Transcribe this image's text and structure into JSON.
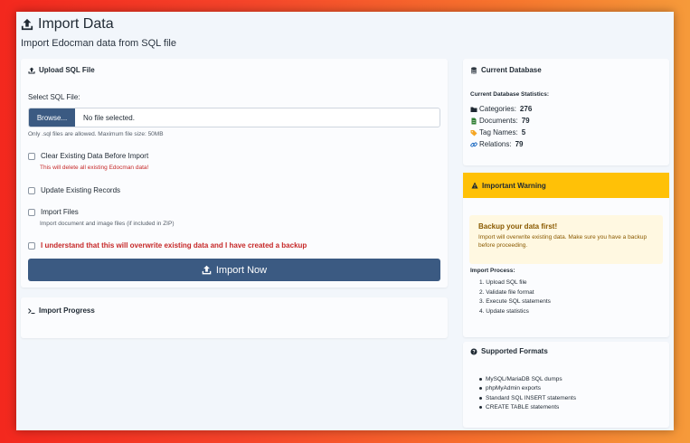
{
  "header": {
    "title": "Import Data",
    "subtitle": "Import Edocman data from SQL file"
  },
  "upload": {
    "card_title": "Upload SQL File",
    "file_label": "Select SQL File:",
    "browse_label": "Browse...",
    "file_value": "No file selected.",
    "hint": "Only .sql files are allowed. Maximum file size: 50MB",
    "options": {
      "clear": {
        "label": "Clear Existing Data Before Import",
        "sub": "This will delete all existing Edocman data!",
        "checked": false
      },
      "update": {
        "label": "Update Existing Records",
        "checked": false
      },
      "files": {
        "label": "Import Files",
        "sub": "Import document and image files (if included in ZIP)",
        "checked": false
      },
      "confirm": {
        "label": "I understand that this will overwrite existing data and I have created a backup",
        "checked": false
      }
    },
    "import_button": "Import Now"
  },
  "progress": {
    "card_title": "Import Progress"
  },
  "database": {
    "card_title": "Current Database",
    "stats_title": "Current Database Statistics:",
    "stats": [
      {
        "label": "Categories:",
        "value": "276",
        "icon": "folder-icon"
      },
      {
        "label": "Documents:",
        "value": "79",
        "icon": "document-icon"
      },
      {
        "label": "Tag Names:",
        "value": "5",
        "icon": "tag-icon"
      },
      {
        "label": "Relations:",
        "value": "79",
        "icon": "link-icon"
      }
    ]
  },
  "warning": {
    "card_title": "Important Warning",
    "alert_title": "Backup your data first!",
    "alert_text": "Import will overwrite existing data. Make sure you have a backup before proceeding.",
    "process_title": "Import Process:",
    "steps": [
      "1. Upload SQL file",
      "2. Validate file format",
      "3. Execute SQL statements",
      "4. Update statistics"
    ]
  },
  "formats": {
    "card_title": "Supported Formats",
    "items": [
      "MySQL/MariaDB SQL dumps",
      "phpMyAdmin exports",
      "Standard SQL INSERT statements",
      "CREATE TABLE statements"
    ]
  },
  "colors": {
    "primary": "#3b5a82",
    "warning": "#ffc107",
    "danger": "#c62828"
  }
}
